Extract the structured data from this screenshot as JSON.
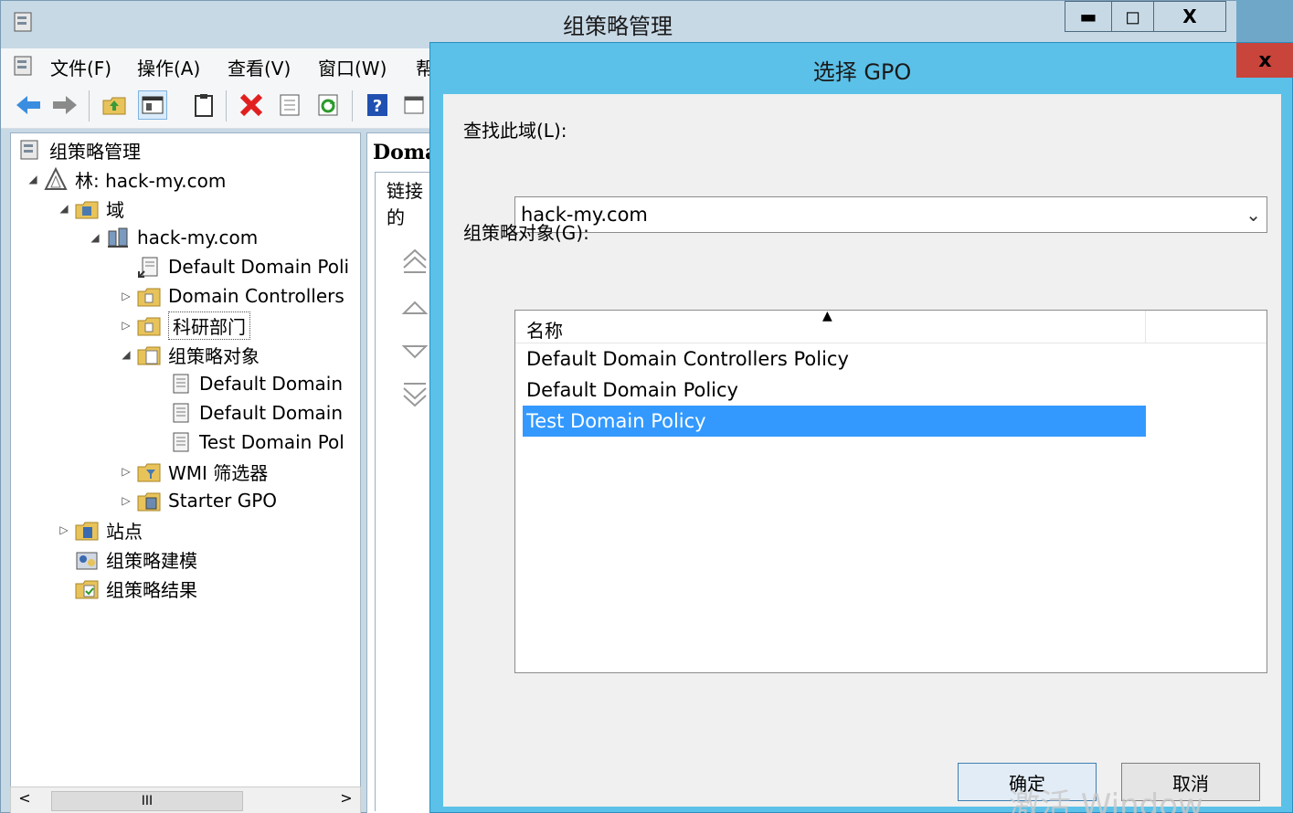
{
  "main_window": {
    "title": "组策略管理",
    "controls": {
      "minimize": "▬",
      "maximize": "◻",
      "close": "X"
    }
  },
  "menu": [
    "文件(F)",
    "操作(A)",
    "查看(V)",
    "窗口(W)",
    "帮"
  ],
  "toolbar": [
    "back-arrow",
    "forward-arrow",
    "up-folder",
    "show-hide-tree",
    "clipboard",
    "delete",
    "properties",
    "refresh",
    "help",
    "panel"
  ],
  "tree": {
    "root": "组策略管理",
    "forest": "林: hack-my.com",
    "domains": "域",
    "domain": "hack-my.com",
    "default_domain_policy_link": "Default Domain Poli",
    "domain_controllers": "Domain Controllers",
    "research_dept": "科研部门",
    "gpo_container": "组策略对象",
    "gpo_items": [
      "Default Domain",
      "Default Domain",
      "Test Domain Pol"
    ],
    "wmi_filters": "WMI 筛选器",
    "starter_gpo": "Starter GPO",
    "sites": "站点",
    "modeling": "组策略建模",
    "results": "组策略结果"
  },
  "scrollbar": {
    "thumb": "III",
    "left": "<",
    "right": ">"
  },
  "right_panel": {
    "header": "Doma",
    "tab_label": "链接的"
  },
  "dialog": {
    "title": "选择 GPO",
    "close": "x",
    "domain_label": "查找此域(L):",
    "domain_value": "hack-my.com",
    "gpo_label": "组策略对象(G):",
    "column_name": "名称",
    "gpos": [
      "Default Domain Controllers Policy",
      "Default Domain Policy",
      "Test Domain Policy"
    ],
    "selected_index": 2,
    "ok": "确定",
    "cancel": "取消"
  },
  "watermark": "激活 Window",
  "colors": {
    "selection": "#3399ff",
    "dialog_frame": "#5bc1e8",
    "close_red": "#c9443a"
  }
}
